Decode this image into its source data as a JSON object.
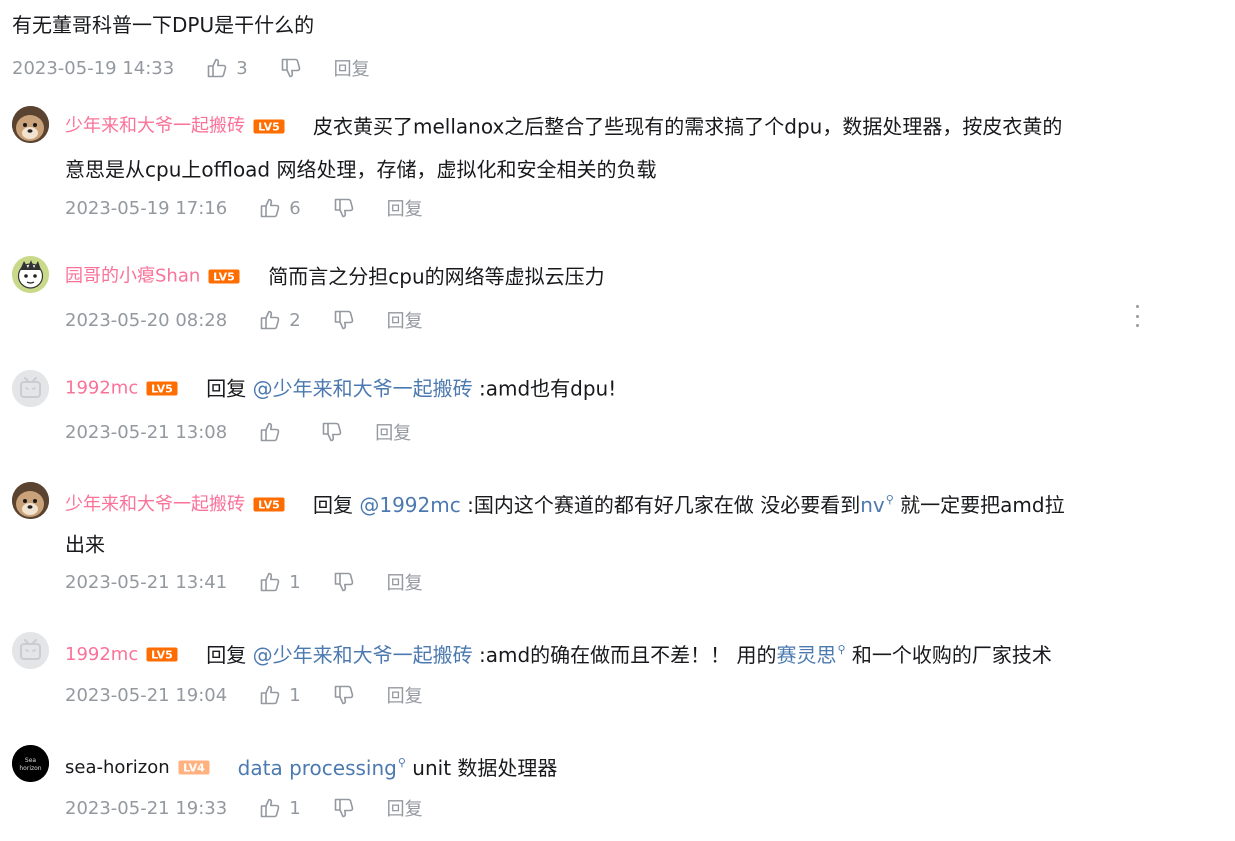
{
  "main_comment": {
    "text": "有无董哥科普一下DPU是干什么的",
    "time": "2023-05-19 14:33",
    "likes": "3",
    "reply_label": "回复"
  },
  "replies": [
    {
      "user": "少年来和大爷一起搬砖",
      "level": "LV5",
      "text_line1": "皮衣黄买了mellanox之后整合了些现有的需求搞了个dpu，数据处理器，按皮衣黄的",
      "text_line2": "意思是从cpu上offload 网络处理，存储，虚拟化和安全相关的负载",
      "time": "2023-05-19 17:16",
      "likes": "6",
      "reply_label": "回复"
    },
    {
      "user": "园哥的小瘪Shan",
      "level": "LV5",
      "text": "简而言之分担cpu的网络等虚拟云压力",
      "time": "2023-05-20 08:28",
      "likes": "2",
      "reply_label": "回复"
    },
    {
      "user": "1992mc",
      "level": "LV5",
      "prefix": "回复 ",
      "mention": "@少年来和大爷一起搬砖",
      "text": " :amd也有dpu!",
      "time": "2023-05-21 13:08",
      "likes": "",
      "reply_label": "回复"
    },
    {
      "user": "少年来和大爷一起搬砖",
      "level": "LV5",
      "prefix": "回复 ",
      "mention": "@1992mc",
      "text_a": " :国内这个赛道的都有好几家在做 没必要看到",
      "keyword": "nv",
      "text_b": " 就一定要把amd拉",
      "text_line2": "出来",
      "time": "2023-05-21 13:41",
      "likes": "1",
      "reply_label": "回复"
    },
    {
      "user": "1992mc",
      "level": "LV5",
      "prefix": "回复 ",
      "mention": "@少年来和大爷一起搬砖",
      "text_a": " :amd的确在做而且不差！！ 用的",
      "keyword": "赛灵思",
      "text_b": " 和一个收购的厂家技术",
      "time": "2023-05-21 19:04",
      "likes": "1",
      "reply_label": "回复"
    },
    {
      "user": "sea-horizon",
      "level": "LV4",
      "keyword": "data processing",
      "text": " unit 数据处理器",
      "time": "2023-05-21 19:33",
      "likes": "1",
      "reply_label": "回复"
    }
  ],
  "colors": {
    "username": "#fb7299",
    "link": "#4c7ab0",
    "meta": "#9499a0",
    "level5": "#ff6c00",
    "level4": "#ffb27f"
  },
  "icons": [
    "thumbs-up-icon",
    "thumbs-down-icon",
    "more-vertical-icon"
  ]
}
